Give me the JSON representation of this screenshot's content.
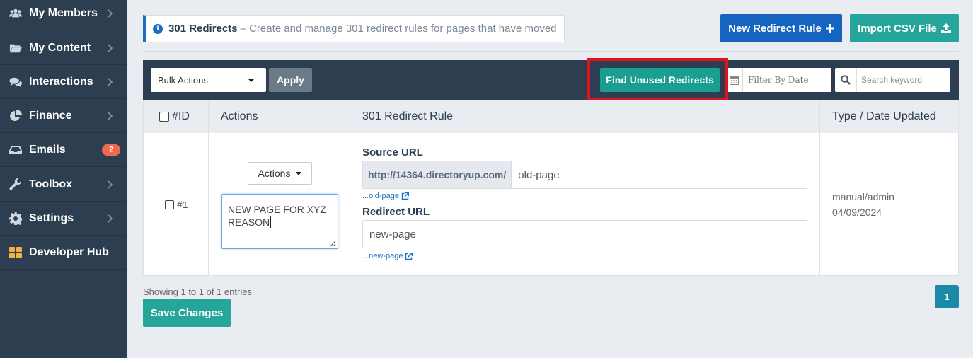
{
  "sidebar": {
    "items": [
      {
        "label": "My Members",
        "icon": "users-icon"
      },
      {
        "label": "My Content",
        "icon": "folder-open-icon"
      },
      {
        "label": "Interactions",
        "icon": "comments-icon"
      },
      {
        "label": "Finance",
        "icon": "pie-chart-icon"
      },
      {
        "label": "Emails",
        "icon": "inbox-icon",
        "badge": "2"
      },
      {
        "label": "Toolbox",
        "icon": "wrench-icon"
      },
      {
        "label": "Settings",
        "icon": "gear-icon"
      },
      {
        "label": "Developer Hub",
        "icon": "grid-icon"
      }
    ]
  },
  "info": {
    "title": "301 Redirects",
    "description": "– Create and manage 301 redirect rules for pages that have moved"
  },
  "header_buttons": {
    "new_rule": "New Redirect Rule",
    "import_csv": "Import CSV File"
  },
  "toolbar": {
    "bulk_actions": "Bulk Actions",
    "apply": "Apply",
    "find_unused": "Find Unused Redirects",
    "filter_date_placeholder": "Filter By Date",
    "search_placeholder": "Search keyword"
  },
  "table": {
    "headers": {
      "id": "#ID",
      "actions": "Actions",
      "rule": "301 Redirect Rule",
      "type_date": "Type / Date Updated"
    },
    "row": {
      "id": "#1",
      "actions_label": "Actions",
      "note": "NEW PAGE FOR XYZ REASON",
      "source_label": "Source URL",
      "source_prefix": "http://14364.directoryup.com/",
      "source_value": "old-page",
      "source_link": "...old-page",
      "redirect_label": "Redirect URL",
      "redirect_value": "new-page",
      "redirect_link": "...new-page",
      "type": "manual/admin",
      "date": "04/09/2024"
    }
  },
  "footer": {
    "showing": "Showing 1 to 1 of 1 entries",
    "save": "Save Changes",
    "page": "1"
  },
  "colors": {
    "sidebar_bg": "#2c3e50",
    "primary_blue": "#1565c0",
    "teal": "#26a69a",
    "highlight_red": "#e0121b",
    "badge_orange": "#f0694a"
  }
}
